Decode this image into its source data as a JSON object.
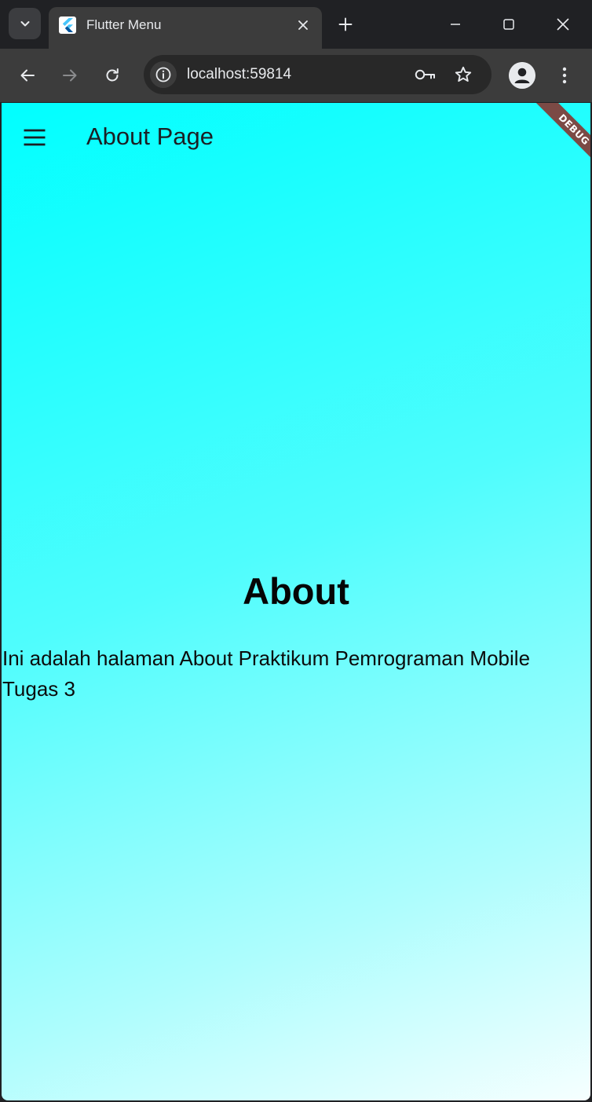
{
  "browser": {
    "tab": {
      "title": "Flutter Menu"
    },
    "address_bar": {
      "url": "localhost:59814"
    }
  },
  "app": {
    "appbar_title": "About Page",
    "debug_banner": "DEBUG",
    "heading": "About",
    "body_text": "Ini adalah halaman About Praktikum Pemrograman Mobile Tugas 3",
    "gradient_colors": [
      "#00ffff",
      "#ffffff"
    ]
  },
  "icons": {
    "tab_search": "chevron-down-icon",
    "favicon": "flutter-logo-icon",
    "tab_close": "close-icon",
    "new_tab": "plus-icon",
    "minimize": "minimize-icon",
    "maximize": "maximize-icon",
    "close_window": "close-icon",
    "back": "arrow-left-icon",
    "forward": "arrow-right-icon",
    "reload": "reload-icon",
    "site_info": "info-icon",
    "passwords": "key-icon",
    "bookmark": "star-icon",
    "profile": "person-icon",
    "menu": "kebab-menu-icon",
    "drawer": "hamburger-menu-icon"
  }
}
